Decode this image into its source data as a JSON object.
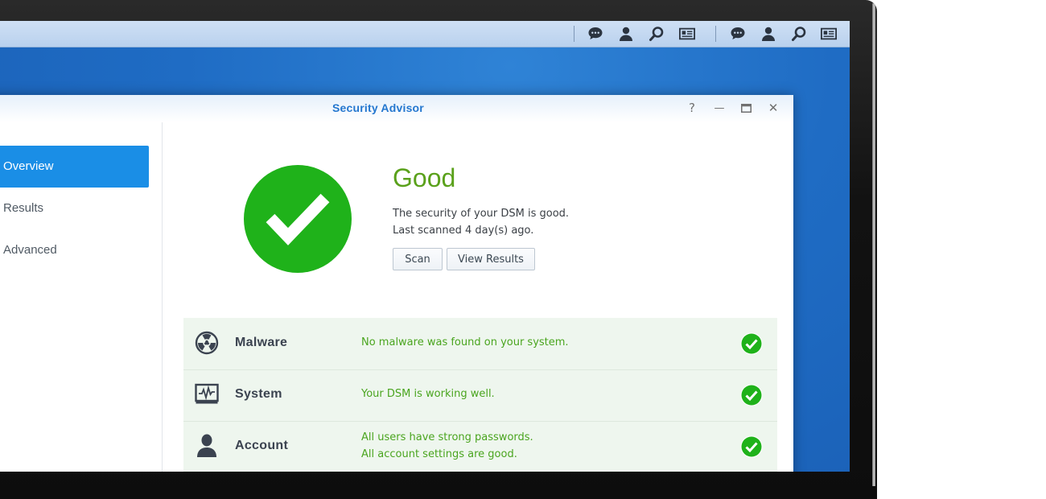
{
  "window": {
    "title": "Security Advisor",
    "help_label": "?",
    "minimize_label": "—",
    "close_label": "✕"
  },
  "taskbar": {
    "icons": [
      "chat-icon",
      "user-icon",
      "search-icon",
      "widgets-icon",
      "chat-icon",
      "user-icon",
      "search-icon",
      "widgets-icon"
    ]
  },
  "sidebar": {
    "items": [
      {
        "label": "Overview",
        "active": true
      },
      {
        "label": "Results",
        "active": false
      },
      {
        "label": "Advanced",
        "active": false
      }
    ]
  },
  "status": {
    "title": "Good",
    "description": "The security of your DSM is good.",
    "last_scanned": "Last scanned 4 day(s) ago.",
    "scan_button": "Scan",
    "view_results_button": "View Results"
  },
  "checks": [
    {
      "icon": "radiation-icon",
      "label": "Malware",
      "messages": [
        "No malware was found on your system."
      ],
      "status": "ok"
    },
    {
      "icon": "system-monitor-icon",
      "label": "System",
      "messages": [
        "Your DSM is working well."
      ],
      "status": "ok"
    },
    {
      "icon": "user-icon",
      "label": "Account",
      "messages": [
        "All users have strong passwords.",
        "All account settings are good."
      ],
      "status": "ok"
    }
  ],
  "colors": {
    "accent": "#1a8ee6",
    "good": "#1fb21a",
    "good_text": "#5aa11b",
    "title_blue": "#2477cf"
  }
}
